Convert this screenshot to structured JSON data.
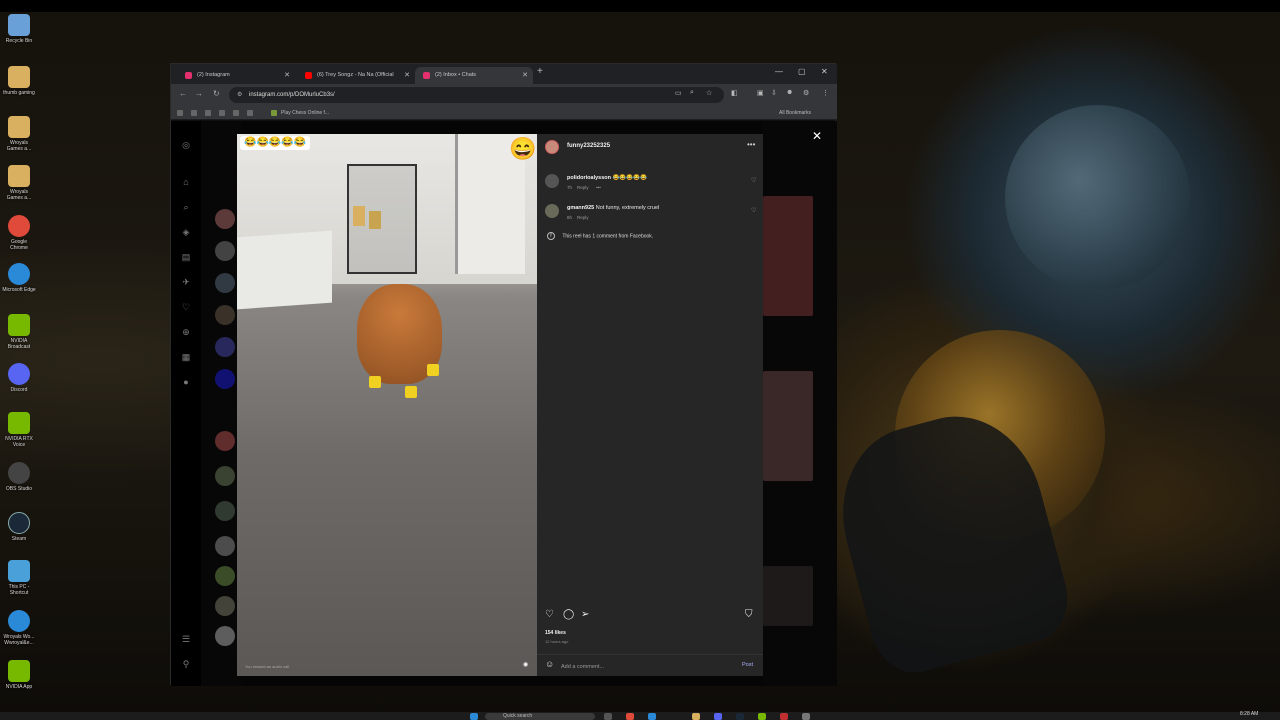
{
  "desktop": {
    "icons": [
      {
        "label": "Recycle Bin",
        "color": "#6aa0d8"
      },
      {
        "label": "thumb gaming",
        "color": "#d8b060"
      },
      {
        "label": "Wroyals Games a...",
        "color": "#d8b060"
      },
      {
        "label": "Wroyals Games a...",
        "color": "#d8b060"
      },
      {
        "label": "Google Chrome",
        "color": "#e04a3a"
      },
      {
        "label": "Microsoft Edge",
        "color": "#2a8ad8"
      },
      {
        "label": "NVIDIA Broadcast",
        "color": "#76b900"
      },
      {
        "label": "Discord",
        "color": "#5865f2"
      },
      {
        "label": "NVIDIA RTX Voice",
        "color": "#76b900"
      },
      {
        "label": "OBS Studio",
        "color": "#444444"
      },
      {
        "label": "Steam",
        "color": "#1b2838"
      },
      {
        "label": "This PC - Shortcut",
        "color": "#4aa0d8"
      },
      {
        "label": "Wroyals Wo... Wwroyal&e...",
        "color": "#2a8ad8"
      },
      {
        "label": "NVIDIA App",
        "color": "#76b900"
      }
    ],
    "taskbar": {
      "search_placeholder": "Quick search",
      "clock": "8:28 AM"
    }
  },
  "browser": {
    "tabs": [
      {
        "label": "(2) Instagram",
        "active": false,
        "fav_color": "#e1306c"
      },
      {
        "label": "(6) Trey Songz - Na Na (Official",
        "active": false,
        "fav_color": "#ff0000"
      },
      {
        "label": "(2) Inbox • Chats",
        "active": true,
        "fav_color": "#e1306c"
      }
    ],
    "url": "instagram.com/p/DOMurluCb3s/",
    "bookmarks": {
      "item": "Play Chess Online f...",
      "all": "All Bookmarks"
    }
  },
  "reel": {
    "emoji_strip": "😂😂😂😂😂",
    "emoji_corner": "😄",
    "video_caption": "You missed an audio call"
  },
  "panel": {
    "username": "funny23252325",
    "comments": [
      {
        "user": "polidorioalysson",
        "text": "😂😂😂😂😂",
        "age": "7h",
        "reply": "Reply",
        "extra": "•••"
      },
      {
        "user": "gmann925",
        "text": "Not funny, extremely cruel",
        "age": "8h",
        "reply": "Reply",
        "extra": ""
      }
    ],
    "facebook_note": "This reel has 1 comment from Facebook.",
    "likes": "154 likes",
    "time_ago": "12 hours ago",
    "add_comment_placeholder": "Add a comment...",
    "post_label": "Post"
  }
}
